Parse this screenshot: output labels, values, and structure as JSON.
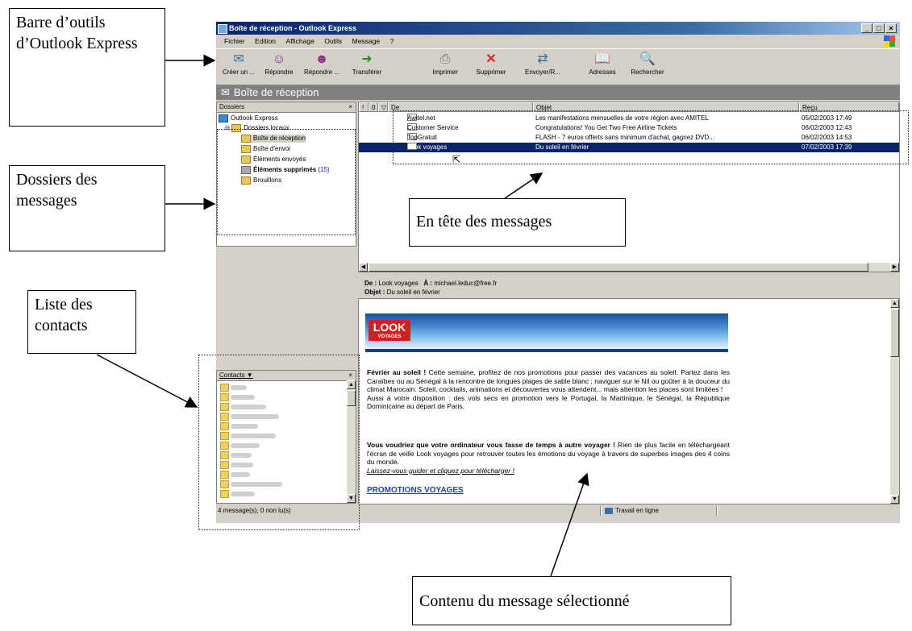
{
  "annotations": {
    "toolbar": "Barre d’outils d’Outlook Express",
    "folders": "Dossiers des messages",
    "contacts": "Liste des contacts",
    "headers": "En tête des messages",
    "content": "Contenu du message sélectionné"
  },
  "window": {
    "title": "Boîte de réception - Outlook Express",
    "controls": [
      "_",
      "□",
      "×"
    ]
  },
  "menu": [
    "Fichier",
    "Edition",
    "Affichage",
    "Outils",
    "Message",
    "?"
  ],
  "toolbar": [
    {
      "label": "Créer un ...",
      "icon": "create-mail-icon"
    },
    {
      "label": "Répondre",
      "icon": "reply-icon"
    },
    {
      "label": "Répondre ...",
      "icon": "reply-all-icon"
    },
    {
      "label": "Transférer",
      "icon": "forward-icon"
    },
    {
      "label": "Imprimer",
      "icon": "print-icon"
    },
    {
      "label": "Supprimer",
      "icon": "delete-icon"
    },
    {
      "label": "Envoyer/R...",
      "icon": "send-receive-icon"
    },
    {
      "label": "Adresses",
      "icon": "address-book-icon"
    },
    {
      "label": "Rechercher",
      "icon": "find-icon"
    }
  ],
  "folder_header": "Boîte de réception",
  "folders_pane": {
    "title": "Dossiers",
    "close": "×",
    "root": "Outlook Express",
    "local": "Dossiers locaux",
    "items": [
      {
        "label": "Boîte de réception",
        "selected": true
      },
      {
        "label": "Boîte d'envoi"
      },
      {
        "label": "Éléments envoyés"
      },
      {
        "label": "Éléments supprimés",
        "count": "(15)",
        "bold": true
      },
      {
        "label": "Brouillons"
      }
    ]
  },
  "contacts_pane": {
    "title": "Contacts ▼",
    "close": "×"
  },
  "message_list": {
    "columns": [
      "!",
      "0",
      "▽",
      "De",
      "Objet",
      "Reçu"
    ],
    "rows": [
      {
        "from": "Awitel.net",
        "subject": "Les manifestations mensuelles de votre région avec AMITEL",
        "received": "05/02/2003 17:49"
      },
      {
        "from": "Customer Service",
        "subject": "Congratulations! You Get Two Free Airline Tickets",
        "received": "06/02/2003 12:43"
      },
      {
        "from": "TopGratuit",
        "subject": "FLASH - 7 euros offerts sans minimum d'achat, gagnez DVD...",
        "received": "06/02/2003 14:53"
      },
      {
        "from": "Look voyages",
        "subject": "Du soleil en février",
        "received": "07/02/2003 17:39",
        "selected": true
      }
    ]
  },
  "preview": {
    "from_label": "De :",
    "from": "Look voyages",
    "to_label": "À :",
    "to": "michael.leduc@free.fr",
    "subject_label": "Objet :",
    "subject": "Du soleil en février",
    "logo_big": "LOOK",
    "logo_small": "VOYAGES",
    "p1_bold": "Février au soleil !",
    "p1": " Cette semaine, profitez de nos promotions pour passer des vacances au soleil. Partez dans les Caraïbes ou au Sénégal à la rencontre de longues plages de sable blanc ; naviguer sur le Nil ou goûter à la douceur du climat Marocain. Soleil, cocktails, animations et découvertes vous attendent... mais attention les places sont limitées !",
    "p1b": "Aussi à votre disposition : des vols secs en promotion vers le Portugal, la Martinique, le Sénégal, la République Dominicaine au départ de Paris.",
    "p2_bold": "Vous voudriez que votre ordinateur vous fasse de temps à autre voyager !",
    "p2": " Rien de plus facile en téléchargeant l'écran de veille Look voyages pour retrouver toutes les émotions du voyage à travers de superbes images des 4 coins du monde.",
    "p2_italic": "Laissez-vous guider et cliquez pour télécharger !",
    "link": "PROMOTIONS VOYAGES"
  },
  "status": {
    "messages": "4 message(s), 0 non lu(s)",
    "online": "Travail en ligne"
  }
}
